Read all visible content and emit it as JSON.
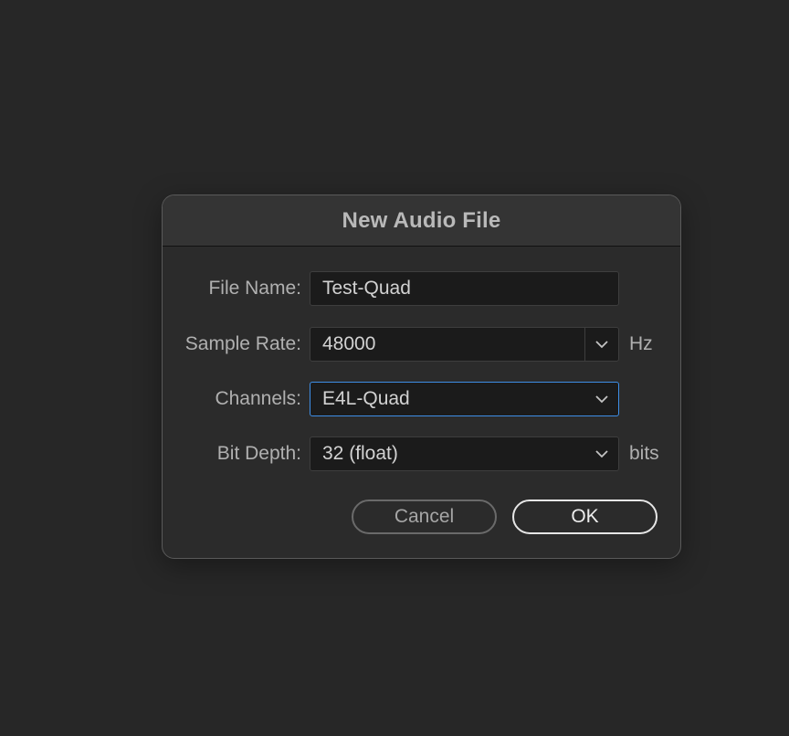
{
  "dialog": {
    "title": "New Audio File",
    "file_name": {
      "label": "File Name:",
      "value": "Test-Quad"
    },
    "sample_rate": {
      "label": "Sample Rate:",
      "value": "48000",
      "unit": "Hz"
    },
    "channels": {
      "label": "Channels:",
      "value": "E4L-Quad"
    },
    "bit_depth": {
      "label": "Bit Depth:",
      "value": "32 (float)",
      "unit": "bits"
    },
    "cancel_label": "Cancel",
    "ok_label": "OK"
  },
  "colors": {
    "background": "#272727",
    "dialog": "#2b2b2b",
    "field": "#1b1b1b",
    "focus_accent": "#3d8ee6"
  },
  "icons": {
    "dropdown": "chevron-down-icon"
  }
}
